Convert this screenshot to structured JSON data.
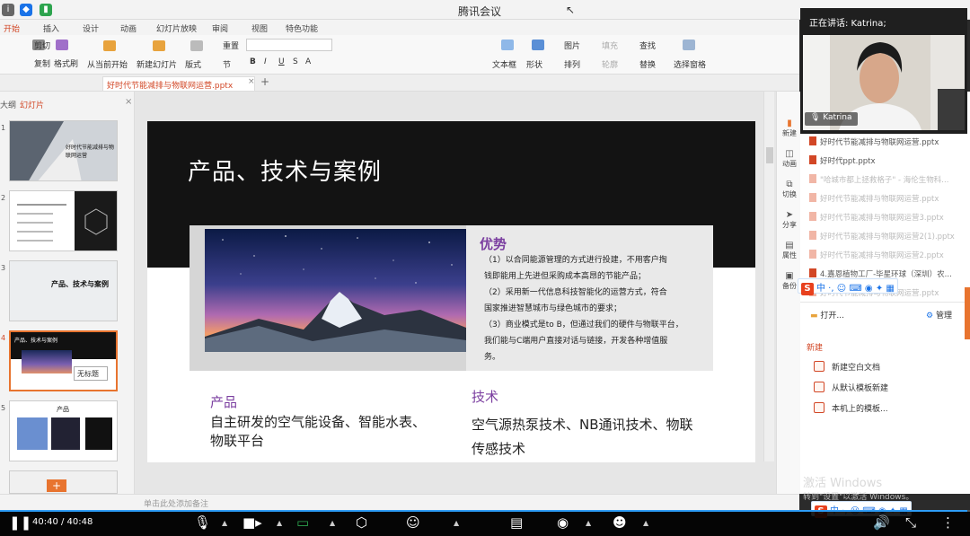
{
  "window": {
    "title": "腾讯会议"
  },
  "ribbon_tabs": [
    "开始",
    "插入",
    "设计",
    "动画",
    "幻灯片放映",
    "审阅",
    "视图",
    "特色功能"
  ],
  "ribbon": {
    "cut": "剪切",
    "copy": "复制",
    "format_painter": "格式刷",
    "from_start": "从当前开始",
    "new_slide": "新建幻灯片",
    "layout": "版式",
    "reset": "重置",
    "section": "节",
    "text_box": "文本框",
    "shapes": "形状",
    "picture": "图片",
    "fill": "填充",
    "arrange": "排列",
    "outline": "轮廓",
    "find": "查找",
    "replace": "替换",
    "select_pane": "选择窗格"
  },
  "doc_tab": "好时代节能减排与物联网运营.pptx",
  "thumb_panel": {
    "tab_outline": "大纲",
    "tab_slides": "幻灯片",
    "tooltip": "无标题"
  },
  "thumbs": [
    {
      "num": "1",
      "caption": "好时代节能减排与物联网运营"
    },
    {
      "num": "2",
      "caption": ""
    },
    {
      "num": "3",
      "caption": "产品、技术与案例"
    },
    {
      "num": "4",
      "caption": "产品、技术与案例"
    },
    {
      "num": "5",
      "caption": "产品"
    }
  ],
  "slide": {
    "title": "产品、技术与案例",
    "advantage": {
      "heading": "优势",
      "lines": [
        "（1）以合同能源管理的方式进行投建，不用客户掏",
        "钱即能用上先进但采购成本高昂的节能产品；",
        "（2）采用新一代信息科技智能化的运营方式，符合",
        "国家推进智慧城市与绿色城市的要求；",
        "（3）商业模式是to B，但通过我们的硬件与物联平台，",
        "我们能与C端用户直接对话与链接，开发各种增值服",
        "务。"
      ]
    },
    "product": {
      "heading": "产品",
      "body": "自主研发的空气能设备、智能水表、物联平台"
    },
    "tech": {
      "heading": "技术",
      "body": "空气源热泵技术、NB通讯技术、物联传感技术"
    }
  },
  "status_bar": {
    "notes_hint": "单击此处添加备注"
  },
  "side_icons": [
    "新建",
    "动画",
    "切换",
    "分享",
    "属性",
    "备份"
  ],
  "taskpane": {
    "files": [
      "好时代节能减排与物联网运营.pptx",
      "好时代ppt.pptx",
      "\"哈城市都上拯救格子\" - 海伦生物科...",
      "好时代节能减排与物联网运营.pptx",
      "好时代节能减排与物联网运营3.pptx",
      "好时代节能减排与物联网运营2(1).pptx",
      "好时代节能减排与物联网运营2.pptx",
      "4.嘉恩植物工厂-毕星环球（深圳）农...",
      "好时代节能减排与物联网运营.pptx"
    ],
    "open": "打开...",
    "manage": "管理",
    "new_heading": "新建",
    "new_blank": "新建空白文档",
    "from_template": "从默认模板新建",
    "local_template": "本机上的模板..."
  },
  "video": {
    "speaking_label": "正在讲话: Katrina;",
    "name": "Katrina"
  },
  "activation": {
    "line1": "激活 Windows",
    "line2": "转到\"设置\"以激活 Windows。"
  },
  "player": {
    "time": "40:40 / 40:48",
    "progress": 0.997
  },
  "ime": {
    "label": "中"
  },
  "colors": {
    "accent": "#d24726",
    "purple": "#7b3fa0",
    "progress": "#2e9df7"
  }
}
